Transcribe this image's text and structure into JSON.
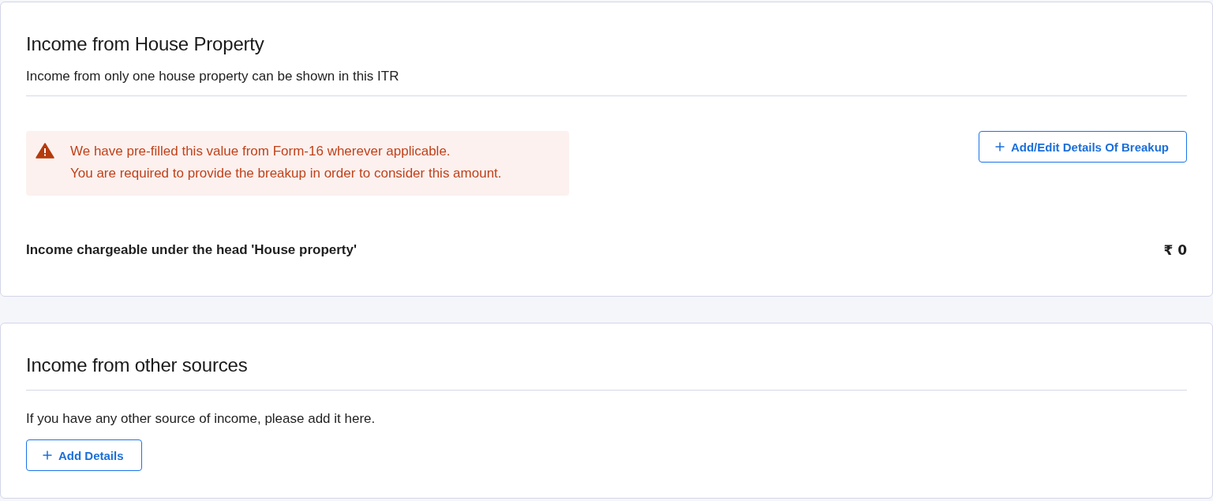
{
  "sections": [
    {
      "kind": "house_property",
      "title": "Income from House Property",
      "subtitle": "Income from only one house property can be shown in this ITR",
      "alert": {
        "lines": [
          "We have pre-filled this value from Form-16 wherever applicable.",
          "You are required to provide the breakup in order to consider this amount."
        ]
      },
      "button": "Add/Edit Details Of Breakup",
      "summary": {
        "label": "Income chargeable under the head 'House property'",
        "amount": "₹ 0"
      }
    },
    {
      "kind": "other_sources",
      "title": "Income from other sources",
      "description": "If you have any other source of income, please add it here.",
      "button": "Add Details"
    }
  ]
}
